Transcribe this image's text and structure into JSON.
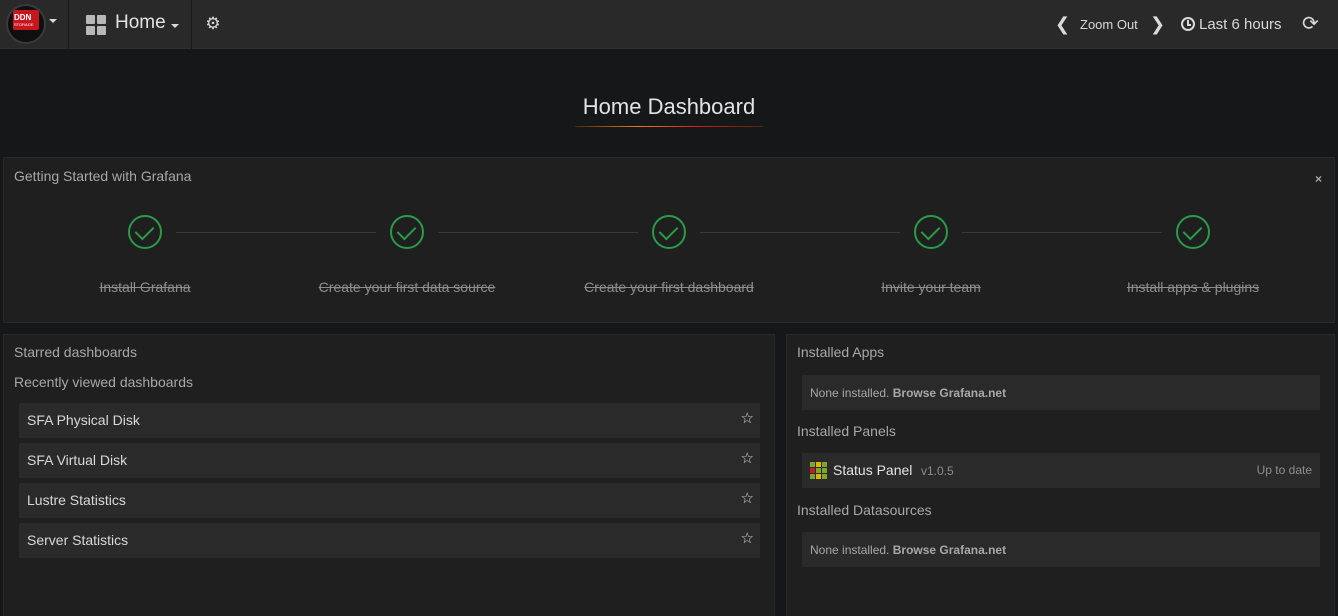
{
  "navbar": {
    "logo_text": "DDN",
    "logo_sub": "STORAGE",
    "dashboard_label": "Home",
    "zoom_out_label": "Zoom Out",
    "time_range_label": "Last 6 hours"
  },
  "title": "Home Dashboard",
  "getting_started": {
    "title": "Getting Started with Grafana",
    "close_label": "×",
    "steps": [
      {
        "label": "Install Grafana"
      },
      {
        "label": "Create your first data source"
      },
      {
        "label": "Create your first dashboard"
      },
      {
        "label": "Invite your team"
      },
      {
        "label": "Install apps & plugins"
      }
    ]
  },
  "left_panel": {
    "starred_label": "Starred dashboards",
    "recent_label": "Recently viewed dashboards",
    "dashboards": [
      {
        "name": "SFA Physical Disk"
      },
      {
        "name": "SFA Virtual Disk"
      },
      {
        "name": "Lustre Statistics"
      },
      {
        "name": "Server Statistics"
      }
    ]
  },
  "right_panel": {
    "apps_label": "Installed Apps",
    "apps_none": "None installed.",
    "apps_browse": "Browse Grafana.net",
    "panels_label": "Installed Panels",
    "panel": {
      "name": "Status Panel",
      "version": "v1.0.5",
      "status": "Up to date"
    },
    "datasources_label": "Installed Datasources",
    "datasources_none": "None installed.",
    "datasources_browse": "Browse Grafana.net"
  },
  "colors": {
    "background": "#161719",
    "panel": "#1f1f20",
    "navbar": "#292929",
    "success": "#299c46",
    "accent": "#eb7b18"
  }
}
